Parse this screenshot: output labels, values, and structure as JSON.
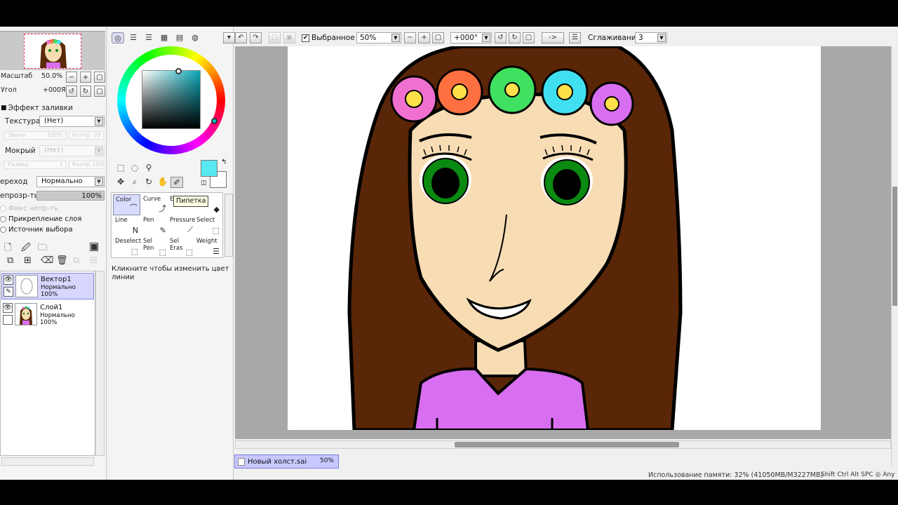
{
  "navigator": {
    "zoom_label": "Масштаб",
    "zoom_value": "50.0%",
    "angle_label": "Угол",
    "angle_value": "+000Я"
  },
  "fill_effect": {
    "title": "Эффект заливки",
    "texture_label": "Текстура",
    "texture_value": "(Нет)",
    "amount_label": "Звено",
    "amount_value": "100%",
    "contrast_label": "Контр. 20",
    "wet_label": "Мокрый",
    "wet_value": "(Нет)",
    "size_label": "Размер",
    "size_value": "1",
    "contrast2_label": "Контр.100"
  },
  "blend": {
    "label": "ереход",
    "value": "Нормально"
  },
  "opacity": {
    "label": "епрозр-ть",
    "value": "100%"
  },
  "options": {
    "protect": "Фикс непр-ть",
    "clip": "Прикрепление слоя",
    "source": "Источник выбора"
  },
  "layers": [
    {
      "name": "Вектор1",
      "mode": "Нормально",
      "opacity": "100%"
    },
    {
      "name": "Слой1",
      "mode": "Нормально",
      "opacity": "100%"
    }
  ],
  "color_panel": {
    "fg_color": "#58e8f0",
    "bg_color": "#ffffff"
  },
  "brushes": [
    {
      "name": "Color"
    },
    {
      "name": "Curve"
    },
    {
      "name": "Е"
    },
    {
      "name": "er"
    },
    {
      "name": "Line"
    },
    {
      "name": "Pen"
    },
    {
      "name": "Pressure"
    },
    {
      "name": "Select"
    },
    {
      "name": "Deselect"
    },
    {
      "name": "Sel\nPen"
    },
    {
      "name": "Sel\nEras"
    },
    {
      "name": "Weight"
    }
  ],
  "tooltip": "Пипетка",
  "hint": "Кликните чтобы изменить цвет линии",
  "toolbar": {
    "selection_label": "Выбранное",
    "zoom_value": "50%",
    "angle_value": "+000°",
    "arrow_btn": "->",
    "smoothing_label": "Сглаживание",
    "smoothing_value": "3"
  },
  "document": {
    "name": "Новый холст.sai",
    "zoom": "50%"
  },
  "status": {
    "memory": "Использование памяти: 32% (41050MB/M3227MB)",
    "keys": "Shift Ctrl Alt SPC ◎ Any"
  },
  "icons": [
    "minus-icon",
    "plus-icon",
    "reset-icon",
    "rotate-icon",
    "new-layer-icon",
    "new-vector-layer-icon",
    "folder-icon",
    "trash-icon",
    "eye-icon",
    "pen-icon",
    "undo-icon",
    "redo-icon",
    "flip-icon"
  ]
}
